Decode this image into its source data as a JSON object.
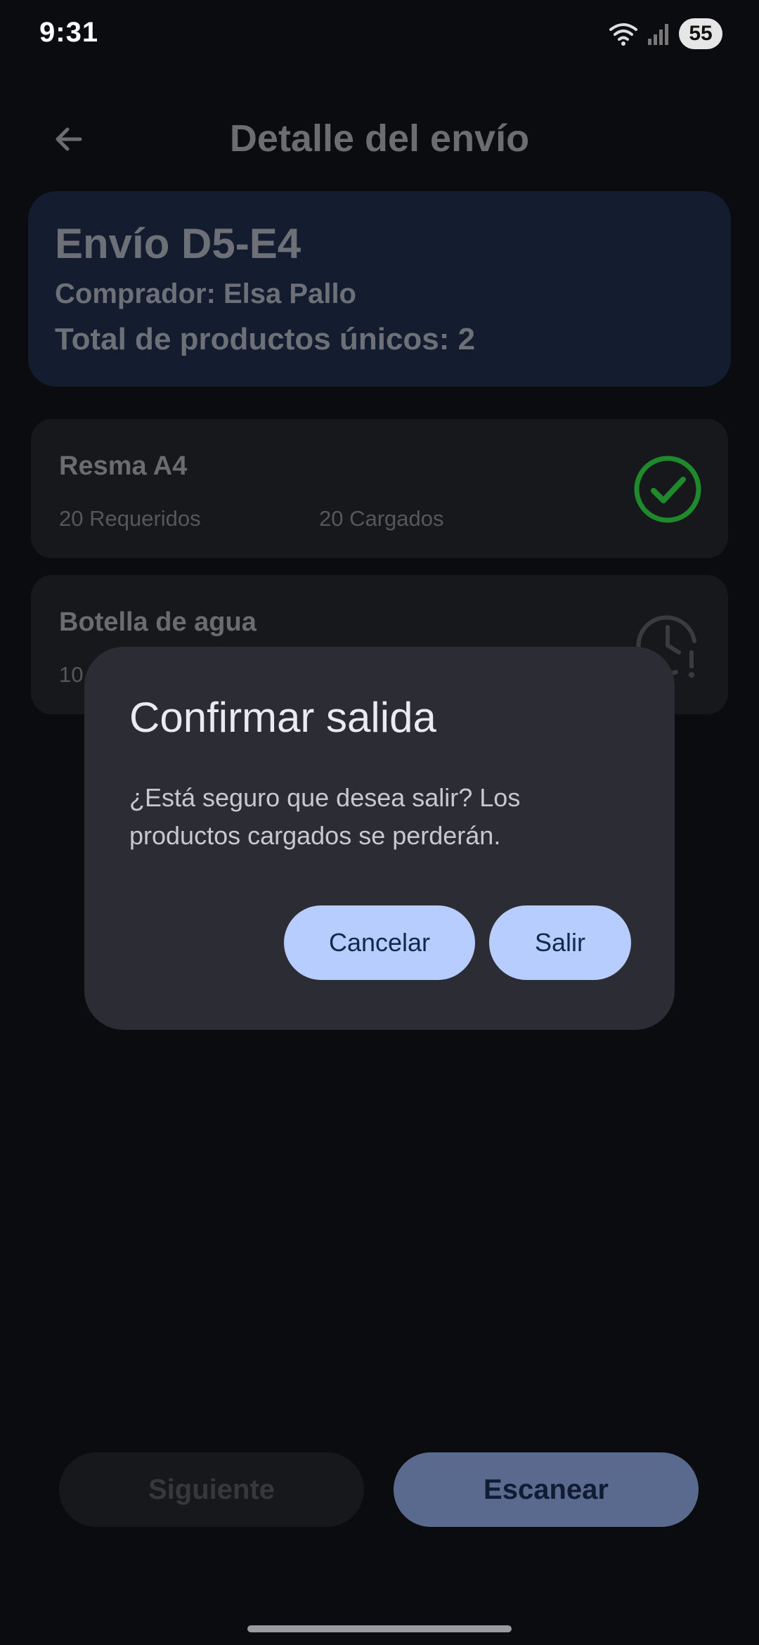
{
  "status_bar": {
    "time": "9:31",
    "battery": "55"
  },
  "header": {
    "title": "Detalle del envío"
  },
  "summary": {
    "title": "Envío D5-E4",
    "buyer": "Comprador: Elsa Pallo",
    "total": "Total de productos únicos: 2"
  },
  "products": [
    {
      "name": "Resma A4",
      "required": "20 Requeridos",
      "loaded": "20 Cargados",
      "status_icon": "check-circle-icon",
      "status_color": "#1f8a2c"
    },
    {
      "name": "Botella de agua",
      "required": "10 Requeridos",
      "loaded": "",
      "status_icon": "clock-alert-icon",
      "status_color": "#3a3b3f"
    }
  ],
  "dialog": {
    "title": "Confirmar salida",
    "message": "¿Está seguro que desea salir? Los productos cargados se perderán.",
    "cancel_label": "Cancelar",
    "confirm_label": "Salir"
  },
  "actions": {
    "next_label": "Siguiente",
    "scan_label": "Escanear"
  },
  "colors": {
    "accent": "#b6cdfd",
    "dialog_bg": "#2b2c34",
    "summary_bg": "#141d30"
  }
}
